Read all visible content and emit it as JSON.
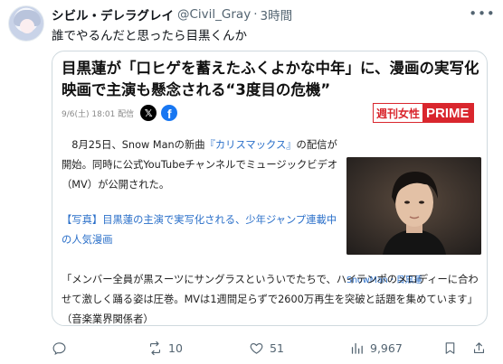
{
  "author": {
    "name": "シビル・デレラグレイ",
    "handle": "@Civil_Gray",
    "separator": "·",
    "time": "3時間"
  },
  "more_icon": "ellipsis-icon",
  "tweet_text": "誰でやるんだと思ったら目黒くんか",
  "card": {
    "title": "目黒蓮が「口ヒゲを蓄えたふくよかな中年」に、漫画の実写化映画で主演も懸念される“3度目の危機”",
    "date": "9/6(土) 18:01 配信",
    "share_icons": [
      "x-icon",
      "facebook-icon"
    ],
    "brand": {
      "part1": "週刊女性",
      "part2": "PRIME",
      "color": "#d9262d"
    },
    "paragraph_prefix": "8月25日、Snow Manの新曲",
    "paragraph_title": "『カリスマックス』",
    "paragraph_suffix": "の配信が開始。同時に公式YouTubeチャンネルでミュージックビデオ（MV）が公開された。",
    "link": "【写真】目黒蓮の主演で実写化される、少年ジャンプ連載中の人気漫画",
    "quote": "「メンバー全員が黒スーツにサングラスといういでたちで、ハイテンポのメロディーに合わせて激しく踊る姿は圧巻。MVは1週間足らずで2600万再生を突破と話題を集めています」（音楽業界関係者）",
    "photo_caption": "SnowMan・目黒蓮"
  },
  "actions": {
    "reply": {
      "icon": "reply-icon",
      "count": ""
    },
    "retweet": {
      "icon": "retweet-icon",
      "count": "10"
    },
    "like": {
      "icon": "heart-icon",
      "count": "51"
    },
    "views": {
      "icon": "views-icon",
      "count": "9,967"
    },
    "bookmark": {
      "icon": "bookmark-icon"
    },
    "share": {
      "icon": "share-icon"
    }
  },
  "colors": {
    "secondary_text": "#536471",
    "link": "#2a6fc9",
    "border": "#cfd9de"
  }
}
